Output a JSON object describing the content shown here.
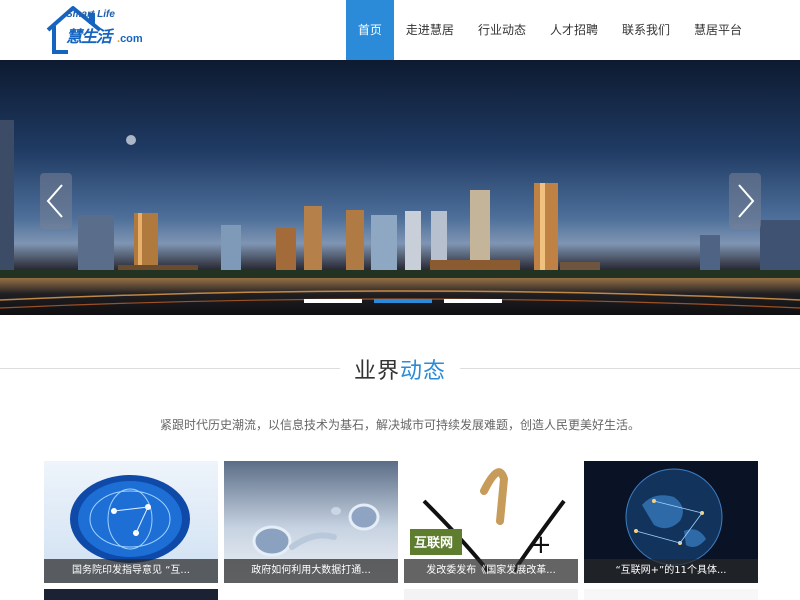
{
  "logo": {
    "en": "Smart Life",
    "cn": "慧生活",
    "dot": ".",
    "com": "com"
  },
  "nav": {
    "items": [
      "首页",
      "走进慧居",
      "行业动态",
      "人才招聘",
      "联系我们",
      "慧居平台"
    ],
    "active_index": 0
  },
  "banner": {
    "slides": 3,
    "active_slide": 1
  },
  "section": {
    "title_plain": "业界",
    "title_highlight": "动态",
    "subtitle": "紧跟时代历史潮流，以信息技术为基石，解决城市可持续发展难题，创造人民更美好生活。"
  },
  "cards": [
    {
      "caption": "国务院印发指导意见 “互...",
      "image": "globe-network-image"
    },
    {
      "caption": "政府如何利用大数据打通...",
      "image": "e-letters-water-image"
    },
    {
      "caption": "发改委发布《国家发展改革...",
      "image": "internet-plus-image"
    },
    {
      "caption": "“互联网+”的11个具体...",
      "image": "world-network-globe-image"
    }
  ],
  "colors": {
    "accent": "#2b8bd8",
    "logo_blue": "#1565c0",
    "logo_orange": "#f39800"
  }
}
